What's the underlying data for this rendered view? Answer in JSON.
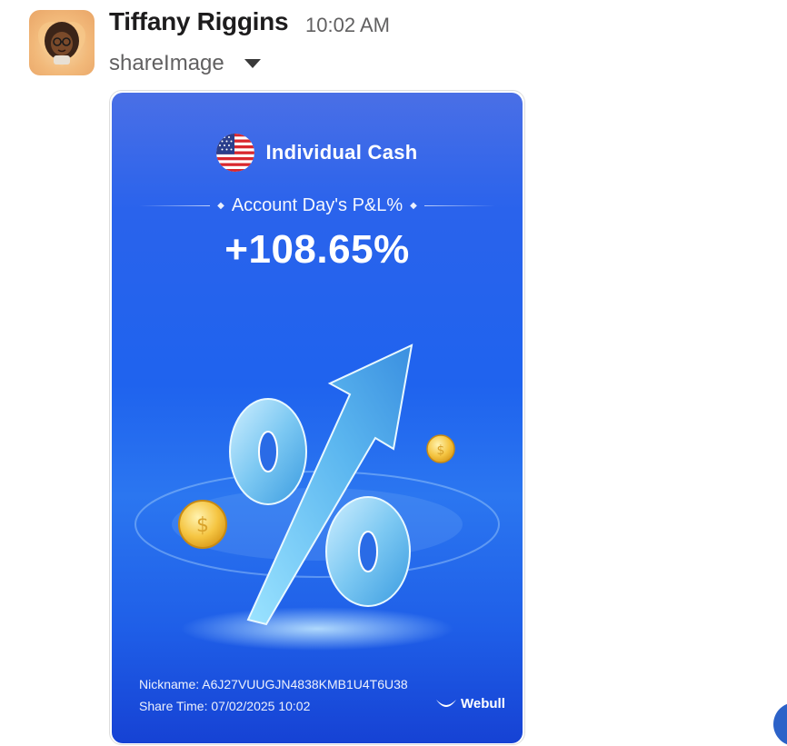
{
  "message": {
    "author": "Tiffany Riggins",
    "timestamp": "10:02 AM",
    "attachment_name": "shareImage"
  },
  "share_card": {
    "account_name": "Individual Cash",
    "metric_label": "Account Day's P&L%",
    "metric_value": "+108.65%",
    "nickname": "Nickname: A6J27VUUGJN4838KMB1U4T6U38",
    "share_time": "Share Time: 07/02/2025 10:02",
    "brand": "Webull"
  },
  "icons": {
    "flag": "us-flag-icon",
    "menu": "chevron-down-icon",
    "brand": "webull-logo-icon"
  },
  "colors": {
    "card_top": "#4a6fe6",
    "card_bottom": "#1642d4",
    "author_text": "#1d1c1d",
    "meta_text": "#616061"
  }
}
